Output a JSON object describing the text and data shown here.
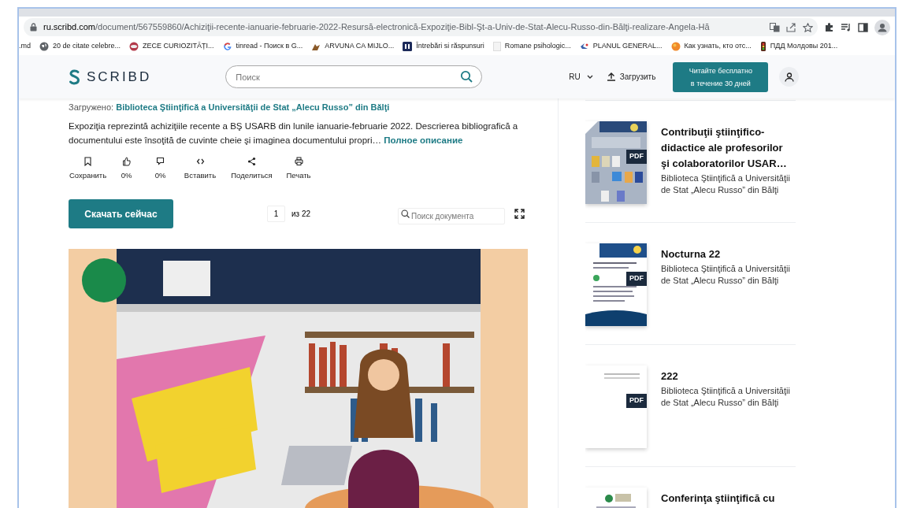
{
  "browser": {
    "url_host": "ru.scribd.com",
    "url_path": "/document/567559860/Achiziţii-recente-ianuarie-februarie-2022-Resursă-electronică-Expoziţie-Bibl-Şt-a-Univ-de-Stat-Alecu-Russo-din-Bălţi-realizare-Angela-Hă",
    "bookmarks": [
      {
        "label": ".md"
      },
      {
        "label": "20 de citate celebre..."
      },
      {
        "label": "ZECE CURIOZITĂȚI..."
      },
      {
        "label": "tinread - Поиск в G..."
      },
      {
        "label": "ARVUNA CA MIJLO..."
      },
      {
        "label": "Întrebări si răspunsuri"
      },
      {
        "label": "Romane psihologic..."
      },
      {
        "label": "PLANUL GENERAL..."
      },
      {
        "label": "Как узнать, кто отс..."
      },
      {
        "label": "ПДД Молдовы 201..."
      }
    ]
  },
  "header": {
    "logo": "SCRIBD",
    "search_placeholder": "Поиск",
    "language": "RU",
    "upload": "Загрузить",
    "cta_lines": [
      "Читайте бесплатно",
      "в течение 30 дней"
    ]
  },
  "document": {
    "uploaded_label": "Загружено:",
    "uploader": "Biblioteca Ştiinţifică a Universităţii de Stat „Alecu Russo” din Bălţi",
    "description": "Expoziţia reprezintă achiziţiile recente a BŞ USARB din lunile ianuarie-februarie 2022. Descrierea bibliografică a documentului este însoţită de cuvinte cheie şi imaginea documentului propri…",
    "more_link": "Полное описание",
    "actions": [
      {
        "kind": "save",
        "label": "Сохранить"
      },
      {
        "kind": "like",
        "label": "0%"
      },
      {
        "kind": "dislike",
        "label": "0%"
      },
      {
        "kind": "embed",
        "label": "Вставить"
      },
      {
        "kind": "share",
        "label": "Поделиться"
      },
      {
        "kind": "print",
        "label": "Печать"
      }
    ],
    "download": "Скачать сейчас",
    "page": "1",
    "page_total": "из 22",
    "search_placeholder": "Поиск документа"
  },
  "related": [
    {
      "title": "Contribuţii ştiinţifico-didactice ale profesorilor şi colaboratorilor USAR…",
      "author": "Biblioteca Ştiinţifică a Universităţii de Stat „Alecu Russo” din Bălţi",
      "badge": "PDF"
    },
    {
      "title": "Nocturna 22",
      "author": "Biblioteca Ştiinţifică a Universităţii de Stat „Alecu Russo” din Bălţi",
      "badge": "PDF"
    },
    {
      "title": "222",
      "author": "Biblioteca Ştiinţifică a Universităţii de Stat „Alecu Russo” din Bălţi",
      "badge": "PDF"
    },
    {
      "title": "Conferinţa ştiinţifică cu"
    }
  ]
}
